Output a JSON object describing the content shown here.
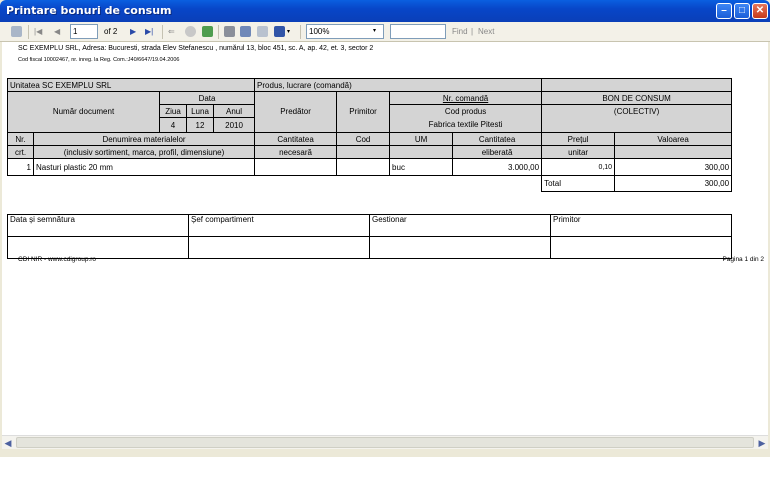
{
  "window": {
    "title": "Printare bonuri de consum"
  },
  "toolbar": {
    "page_current": "1",
    "page_of": "of 2",
    "zoom": "100%",
    "find_label": "Find",
    "next_label": "Next",
    "find_separator": "|"
  },
  "report": {
    "company_line": "SC EXEMPLU SRL, Adresa: Bucuresti, strada Elev Stefanescu , numărul 13, bloc 451, sc. A, ap. 42, et. 3, sector 2",
    "fiscal_line": "Cod fiscal 10002467, nr. inreg. la Reg. Com.:J40/6647/19.04.2006",
    "unit_label": "Unitatea SC EXEMPLU SRL",
    "produs_label": "Produs, lucrare (comandă)",
    "data_label": "Data",
    "numar_document_label": "Număr document",
    "ziua_label": "Ziua",
    "luna_label": "Luna",
    "anul_label": "Anul",
    "ziua": "4",
    "luna": "12",
    "anul": "2010",
    "predator_label": "Predător",
    "primitor_label": "Primitor",
    "nr_comanda_label": "Nr. comandă",
    "cod_produs_label": "Cod produs",
    "cod_produs_value": "Fabrica textile Pitesti",
    "bon_title": "BON DE CONSUM",
    "bon_subtitle": "(COLECTIV)",
    "columns": {
      "nr": "Nr.",
      "crt": "crt.",
      "denumirea": "Denumirea materialelor",
      "denumirea_sub": "(inclusiv sortiment, marca, profil, dimensiune)",
      "cant_necesara": "Cantitatea",
      "cant_necesara_sub": "necesară",
      "cod": "Cod",
      "um": "UM",
      "cant_eliberata": "Cantitatea",
      "cant_eliberata_sub": "eliberată",
      "pretul": "Prețul",
      "pretul_sub": "unitar",
      "valoarea": "Valoarea"
    },
    "rows": [
      {
        "nr": "1",
        "denumirea": "Nasturi plastic 20 mm",
        "cant_necesara": "",
        "cod": "",
        "um": "buc",
        "cant_eliberata": "3.000,00",
        "pret": "0,10",
        "valoare": "300,00"
      }
    ],
    "total_label": "Total",
    "total_value": "300,00",
    "signatures": {
      "data_semnatura": "Data și semnătura",
      "sef": "Șef compartiment",
      "gestionar": "Gestionar",
      "primitor": "Primitor"
    },
    "footer_left": "CDI NIR -  www.cdigroup.ro",
    "footer_right": "Pagina 1 din 2"
  },
  "colors": {
    "titlebar": "#0a5fe0",
    "header_fill": "#d4d4d4"
  }
}
